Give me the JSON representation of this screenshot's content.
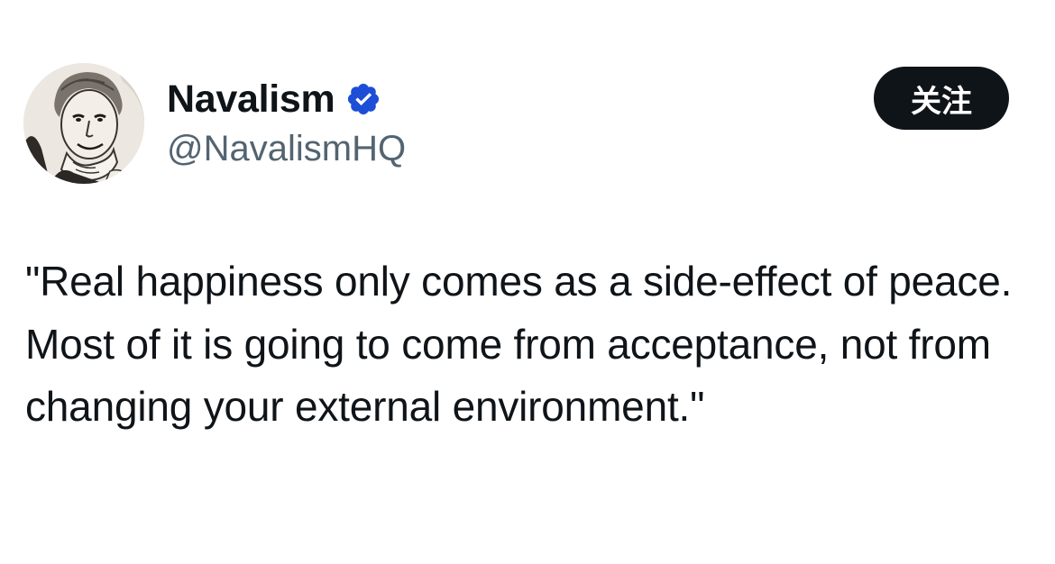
{
  "tweet": {
    "author": {
      "display_name": "Navalism",
      "handle": "@NavalismHQ",
      "verified": true,
      "avatar_icon": "portrait-avatar"
    },
    "follow_label": "关注",
    "text": "\"Real happiness only comes as a side-effect of peace. Most of it is going to come from acceptance, not from changing your external environment.\""
  },
  "colors": {
    "text_primary": "#0f1419",
    "text_secondary": "#536471",
    "verified_badge": "#1d4ed8",
    "button_bg": "#0f1419",
    "button_text": "#ffffff"
  }
}
